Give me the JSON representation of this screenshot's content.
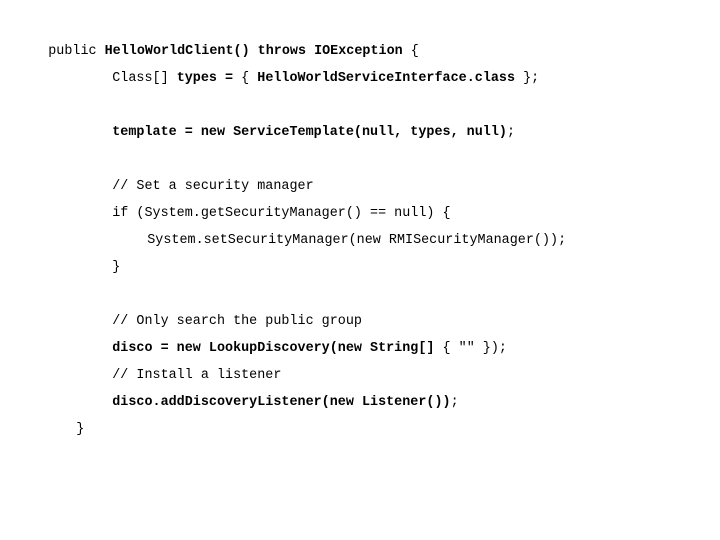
{
  "document": {
    "lines": [
      {
        "segments": [
          {
            "text": "public ",
            "bold": false
          },
          {
            "text": "HelloWorldClient() throws IOException ",
            "bold": true
          },
          {
            "text": "{",
            "bold": false
          }
        ]
      },
      {
        "segments": [
          {
            "text": "Class[] ",
            "bold": false
          },
          {
            "text": "types = ",
            "bold": true
          },
          {
            "text": "{ ",
            "bold": false
          },
          {
            "text": "HelloWorldServiceInterface.class ",
            "bold": true
          },
          {
            "text": "};",
            "bold": false
          }
        ]
      },
      {
        "segments": [
          {
            "text": "template = new ServiceTemplate(null, types, null)",
            "bold": true
          },
          {
            "text": ";",
            "bold": false
          }
        ]
      },
      {
        "segments": [
          {
            "text": "// Set a security manager",
            "bold": false
          }
        ]
      },
      {
        "segments": [
          {
            "text": "if (System.getSecurityManager() == null) {",
            "bold": false
          }
        ]
      },
      {
        "segments": [
          {
            "text": "System.setSecurityManager(new RMISecurityManager());",
            "bold": false
          }
        ]
      },
      {
        "segments": [
          {
            "text": "}",
            "bold": false
          }
        ]
      },
      {
        "segments": [
          {
            "text": "// Only search the public group",
            "bold": false
          }
        ]
      },
      {
        "segments": [
          {
            "text": "disco = new LookupDiscovery(new String[] ",
            "bold": true
          },
          {
            "text": "{ \"\" });",
            "bold": false
          }
        ]
      },
      {
        "segments": [
          {
            "text": "// Install a listener",
            "bold": false
          }
        ]
      },
      {
        "segments": [
          {
            "text": "disco.addDiscoveryListener(new Listener())",
            "bold": true
          },
          {
            "text": ";",
            "bold": false
          }
        ]
      },
      {
        "segments": [
          {
            "text": "}",
            "bold": false
          }
        ]
      }
    ]
  }
}
